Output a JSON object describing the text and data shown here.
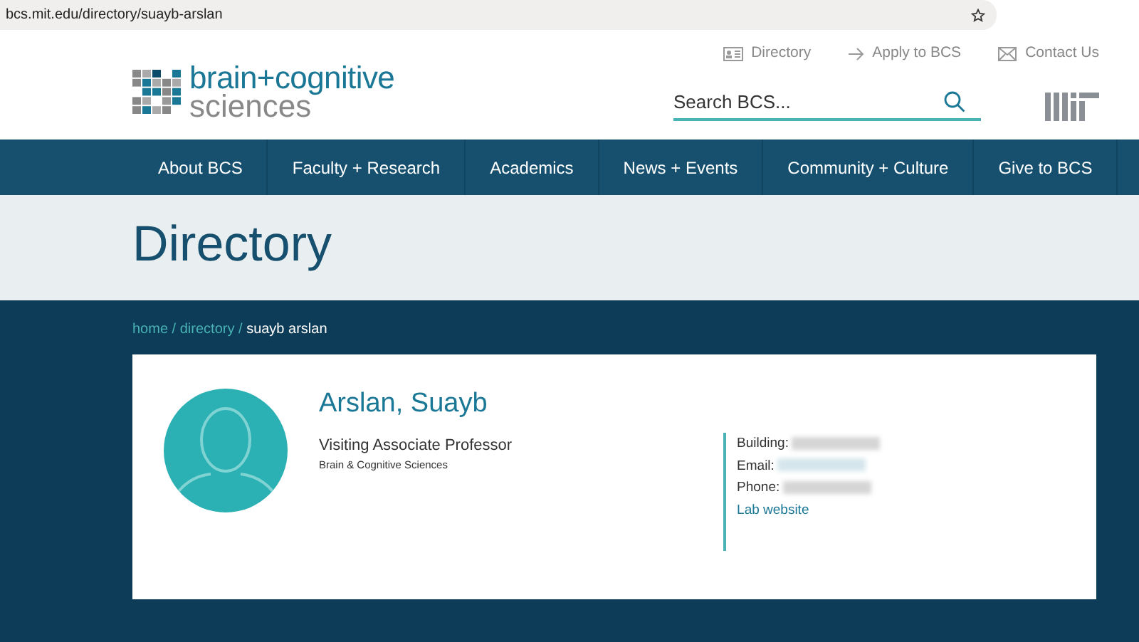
{
  "browser": {
    "url": "bcs.mit.edu/directory/suayb-arslan"
  },
  "header": {
    "logo_line_1": "brain+cognitive",
    "logo_line_2": "sciences",
    "utility_links": [
      {
        "kind": "card",
        "label": "Directory"
      },
      {
        "kind": "arrow",
        "label": "Apply to BCS"
      },
      {
        "kind": "mail",
        "label": "Contact Us"
      }
    ],
    "search": {
      "placeholder": "Search BCS..."
    }
  },
  "nav": [
    "About BCS",
    "Faculty + Research",
    "Academics",
    "News + Events",
    "Community + Culture",
    "Give to BCS"
  ],
  "page_title": "Directory",
  "breadcrumb_separator": "/",
  "breadcrumb": [
    {
      "label": "home",
      "current": false
    },
    {
      "label": "directory",
      "current": false
    },
    {
      "label": "suayb arslan",
      "current": true
    }
  ],
  "profile": {
    "name": "Arslan, Suayb",
    "position": "Visiting Associate Professor",
    "department": "Brain & Cognitive Sciences",
    "contact": [
      {
        "kind": "redacted",
        "label": "Building:"
      },
      {
        "kind": "email",
        "label": "Email:"
      },
      {
        "kind": "redacted",
        "label": "Phone:"
      },
      {
        "kind": "link",
        "label": "Lab website"
      }
    ]
  }
}
